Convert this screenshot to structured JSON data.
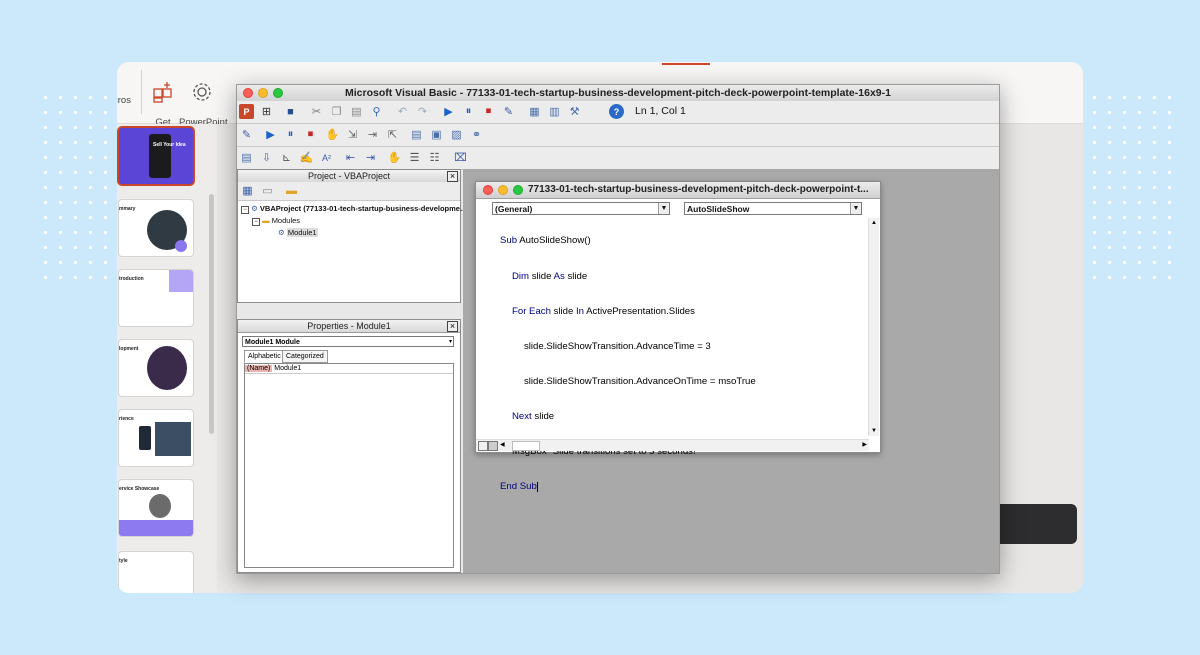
{
  "ribbon": {
    "macros_label": "cros",
    "get_addins_label": "Get\nAdd-ins",
    "ppt_addins_label": "PowerPoint\nAdd-ins"
  },
  "thumbnails": [
    {
      "text": "Sell Your Idea"
    },
    {
      "text": "mmary"
    },
    {
      "text": "troduction"
    },
    {
      "text": "lopment"
    },
    {
      "text": "rience"
    },
    {
      "text": "ervice Showcase"
    },
    {
      "text": "tyle"
    }
  ],
  "vbe": {
    "title": "Microsoft Visual Basic - 77133-01-tech-startup-business-development-pitch-deck-powerpoint-template-16x9-1",
    "cursor_position": "Ln 1, Col 1",
    "project_title": "Project - VBAProject",
    "project_root": "VBAProject (77133-01-tech-startup-business-developme...)",
    "modules_folder": "Modules",
    "module_item": "Module1",
    "properties_title": "Properties - Module1",
    "properties_object": "Module1  Module",
    "tab_alphabetic": "Alphabetic",
    "tab_categorized": "Categorized",
    "prop_name_key": "(Name)",
    "prop_name_value": "Module1",
    "code_window_title": "77133-01-tech-startup-business-development-pitch-deck-powerpoint-t...",
    "object_combo": "(General)",
    "proc_combo": "AutoSlideShow"
  },
  "code": {
    "l1_kw": "Sub",
    "l1_rest": " AutoSlideShow()",
    "l2_kw1": "Dim",
    "l2_mid": " slide ",
    "l2_kw2": "As",
    "l2_rest": " slide",
    "l3_kw1": "For Each",
    "l3_mid": " slide ",
    "l3_kw2": "In",
    "l3_rest": " ActivePresentation.Slides",
    "l4": "slide.SlideShowTransition.AdvanceTime = 3",
    "l5": "slide.SlideShowTransition.AdvanceOnTime = msoTrue",
    "l6_kw": "Next",
    "l6_rest": " slide",
    "l7": "MsgBox \"Slide transitions set to 3 seconds!\"",
    "l8_kw": "End Sub"
  },
  "colors": {
    "keyword": "#00007f",
    "slide_accent": "#7a63e8",
    "background": "#cce8fb"
  }
}
